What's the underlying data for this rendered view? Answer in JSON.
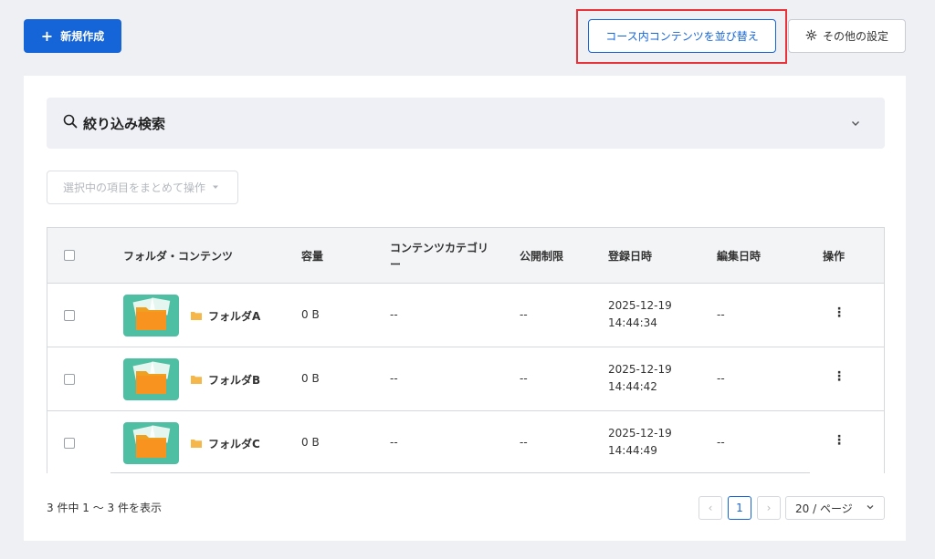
{
  "toolbar": {
    "create_label": "新規作成",
    "sort_label": "コース内コンテンツを並び替え",
    "settings_label": "その他の設定"
  },
  "filter": {
    "label": "絞り込み検索"
  },
  "bulk_action": {
    "label": "選択中の項目をまとめて操作"
  },
  "table": {
    "headers": {
      "name": "フォルダ・コンテンツ",
      "size": "容量",
      "category_line1": "コンテンツカテゴリ",
      "category_line2": "ー",
      "publish": "公開制限",
      "created": "登録日時",
      "edited": "編集日時",
      "actions": "操作"
    },
    "rows": [
      {
        "name": "フォルダA",
        "size": "0 B",
        "category": "--",
        "publish": "--",
        "created_date": "2025-12-19",
        "created_time": "14:44:34",
        "edited": "--"
      },
      {
        "name": "フォルダB",
        "size": "0 B",
        "category": "--",
        "publish": "--",
        "created_date": "2025-12-19",
        "created_time": "14:44:42",
        "edited": "--"
      },
      {
        "name": "フォルダC",
        "size": "0 B",
        "category": "--",
        "publish": "--",
        "created_date": "2025-12-19",
        "created_time": "14:44:49",
        "edited": "--"
      }
    ]
  },
  "footer": {
    "summary": "3 件中 1 ～ 3 件を表示",
    "current_page": "1",
    "page_size": "20 / ページ"
  },
  "colors": {
    "primary": "#1665d8",
    "highlight": "#e8333a",
    "thumb_bg": "#4fbfa4",
    "folder": "#f5a623"
  }
}
